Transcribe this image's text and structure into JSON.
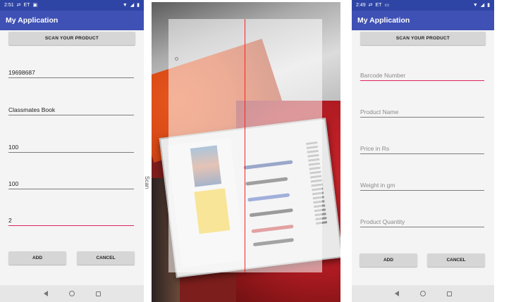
{
  "left_screen": {
    "status": {
      "time": "2:51",
      "carrier": "ET"
    },
    "app_title": "My Application",
    "scan_button": "SCAN YOUR PRODUCT",
    "fields": [
      {
        "value": "19698687"
      },
      {
        "value": "Classmates Book"
      },
      {
        "value": "100"
      },
      {
        "value": "100"
      },
      {
        "value": "2"
      }
    ],
    "add_button": "ADD",
    "cancel_button": "CANCEL"
  },
  "scanner": {
    "side_label": "Scan"
  },
  "right_screen": {
    "status": {
      "time": "2:49",
      "carrier": "ET"
    },
    "app_title": "My Application",
    "scan_button": "SCAN YOUR PRODUCT",
    "fields": [
      {
        "placeholder": "Barcode Number"
      },
      {
        "placeholder": "Product Name"
      },
      {
        "placeholder": "Price in Rs"
      },
      {
        "placeholder": "Weight in gm"
      },
      {
        "placeholder": "Product Quantity"
      }
    ],
    "add_button": "ADD",
    "cancel_button": "CANCEL"
  },
  "colors": {
    "status_bar": "#2f45a6",
    "app_bar": "#3f51b5",
    "active_underline": "#e0245e",
    "laser": "#ff2020"
  }
}
